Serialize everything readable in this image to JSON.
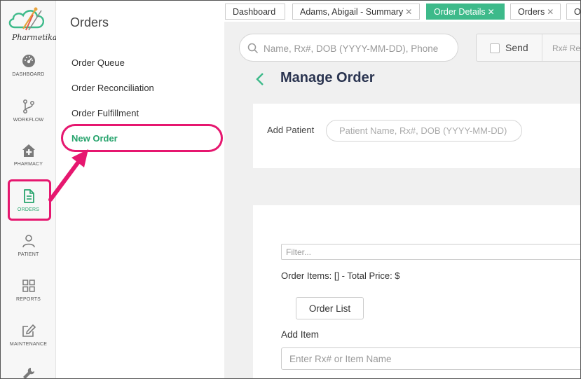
{
  "brand": {
    "name": "Pharmetika"
  },
  "rail": {
    "items": [
      {
        "label": "DASHBOARD",
        "icon": "dashboard-icon"
      },
      {
        "label": "WORKFLOW",
        "icon": "workflow-icon"
      },
      {
        "label": "PHARMACY",
        "icon": "pharmacy-icon"
      },
      {
        "label": "ORDERS",
        "icon": "orders-icon",
        "active": true
      },
      {
        "label": "PATIENT",
        "icon": "patient-icon"
      },
      {
        "label": "REPORTS",
        "icon": "reports-icon"
      },
      {
        "label": "MAINTENANCE",
        "icon": "maintenance-icon"
      },
      {
        "label": "",
        "icon": "wrench-icon"
      }
    ]
  },
  "orders_panel": {
    "title": "Orders",
    "links": [
      {
        "label": "Order Queue"
      },
      {
        "label": "Order Reconciliation"
      },
      {
        "label": "Order Fulfillment"
      },
      {
        "label": "New Order",
        "active": true
      }
    ]
  },
  "tabs": [
    {
      "label": "Dashboard",
      "closable": false
    },
    {
      "label": "Adams, Abigail - Summary",
      "closable": true
    },
    {
      "label": "Order Details",
      "closable": true,
      "active": true
    },
    {
      "label": "Orders",
      "closable": true
    },
    {
      "label": "O",
      "closable": false
    }
  ],
  "header": {
    "search_placeholder": "Name, Rx#, DOB (YYYY-MM-DD), Phone",
    "send_label": "Send",
    "rx_placeholder": "Rx# Re"
  },
  "page": {
    "title": "Manage Order",
    "add_patient_label": "Add Patient",
    "patient_placeholder": "Patient Name, Rx#, DOB (YYYY-MM-DD)",
    "filter_placeholder": "Filter...",
    "order_items_text": "Order Items: [] - Total Price: $",
    "order_list_button": "Order List",
    "add_item_label": "Add Item",
    "item_placeholder": "Enter Rx# or Item Name"
  },
  "colors": {
    "accent": "#3dba8a",
    "active_text": "#27a46d",
    "highlight": "#e6176f",
    "title": "#2a3450"
  }
}
